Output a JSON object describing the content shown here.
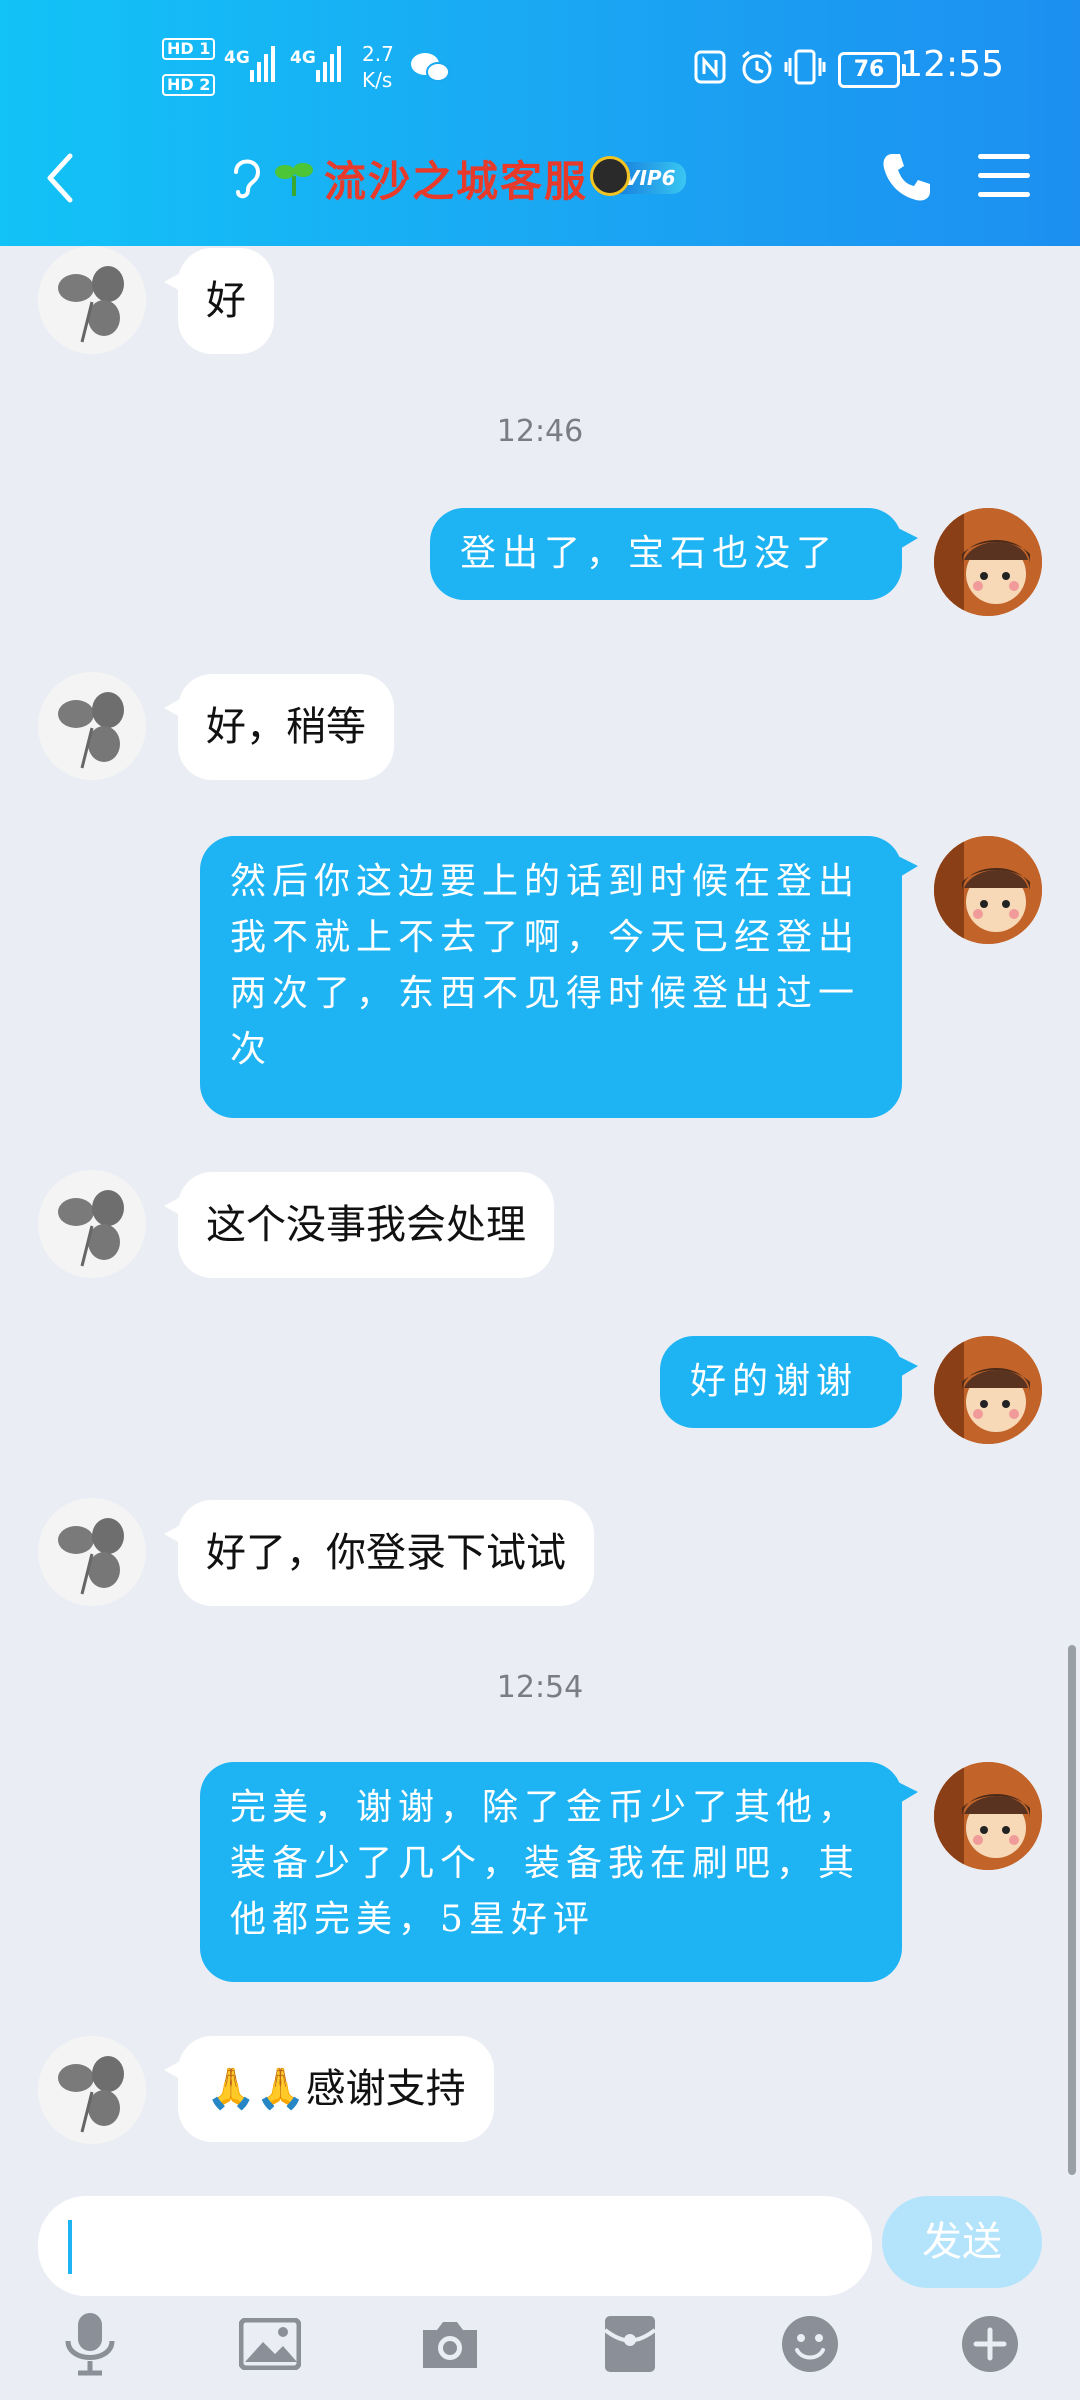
{
  "status_bar": {
    "hd1": "HD 1",
    "hd2": "HD 2",
    "net1": "4G",
    "net2": "4G",
    "speed_value": "2.7",
    "speed_unit": "K/s",
    "battery": "76",
    "time": "12:55"
  },
  "header": {
    "title": "流沙之城客服",
    "vip_badge": "VIP6"
  },
  "messages": [
    {
      "side": "left",
      "text": "好"
    },
    {
      "type": "time",
      "text": "12:46"
    },
    {
      "side": "right",
      "text": "登出了，宝石也没了"
    },
    {
      "side": "left",
      "text": "好，稍等"
    },
    {
      "side": "right",
      "text": "然后你这边要上的话到时候在登出我不就上不去了啊，今天已经登出两次了，东西不见得时候登出过一次"
    },
    {
      "side": "left",
      "text": "这个没事我会处理"
    },
    {
      "side": "right",
      "text": "好的谢谢"
    },
    {
      "side": "left",
      "text": "好了，你登录下试试"
    },
    {
      "type": "time",
      "text": "12:54"
    },
    {
      "side": "right",
      "text": "完美，谢谢，除了金币少了其他，装备少了几个，装备我在刷吧，其他都完美，5星好评"
    },
    {
      "side": "left",
      "emoji": "🙏🙏",
      "text": "感谢支持"
    }
  ],
  "input": {
    "value": "",
    "send_label": "发送"
  },
  "toolbar_icons": [
    "microphone-icon",
    "image-icon",
    "camera-icon",
    "red-packet-icon",
    "emoji-icon",
    "plus-icon"
  ],
  "colors": {
    "header_gradient_start": "#12c3f7",
    "header_gradient_end": "#1c8ff1",
    "outgoing_bubble": "#1eb4f3",
    "incoming_bubble": "#ffffff",
    "title_color": "#e83a2b",
    "background": "#eaedf4"
  }
}
